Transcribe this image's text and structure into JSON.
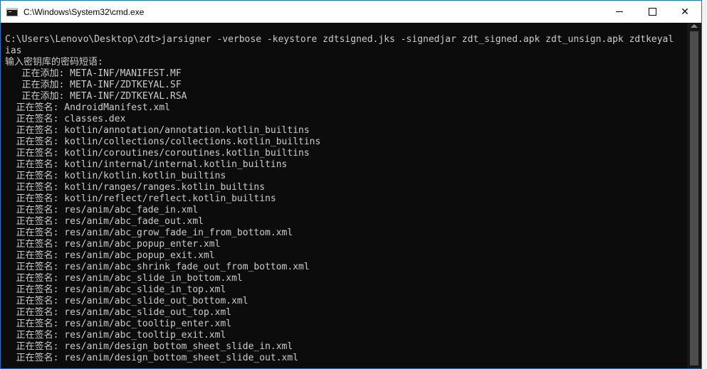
{
  "window": {
    "title": "C:\\Windows\\System32\\cmd.exe",
    "controls": {
      "minimize": "minimize",
      "maximize": "maximize",
      "close": "✕"
    }
  },
  "console": {
    "lines": [
      "C:\\Users\\Lenovo\\Desktop\\zdt>jarsigner -verbose -keystore zdtsigned.jks -signedjar zdt_signed.apk zdt_unsign.apk zdtkeyal",
      "ias",
      "输入密钥库的密码短语:",
      "   正在添加: META-INF/MANIFEST.MF",
      "   正在添加: META-INF/ZDTKEYAL.SF",
      "   正在添加: META-INF/ZDTKEYAL.RSA",
      "  正在签名: AndroidManifest.xml",
      "  正在签名: classes.dex",
      "  正在签名: kotlin/annotation/annotation.kotlin_builtins",
      "  正在签名: kotlin/collections/collections.kotlin_builtins",
      "  正在签名: kotlin/coroutines/coroutines.kotlin_builtins",
      "  正在签名: kotlin/internal/internal.kotlin_builtins",
      "  正在签名: kotlin/kotlin.kotlin_builtins",
      "  正在签名: kotlin/ranges/ranges.kotlin_builtins",
      "  正在签名: kotlin/reflect/reflect.kotlin_builtins",
      "  正在签名: res/anim/abc_fade_in.xml",
      "  正在签名: res/anim/abc_fade_out.xml",
      "  正在签名: res/anim/abc_grow_fade_in_from_bottom.xml",
      "  正在签名: res/anim/abc_popup_enter.xml",
      "  正在签名: res/anim/abc_popup_exit.xml",
      "  正在签名: res/anim/abc_shrink_fade_out_from_bottom.xml",
      "  正在签名: res/anim/abc_slide_in_bottom.xml",
      "  正在签名: res/anim/abc_slide_in_top.xml",
      "  正在签名: res/anim/abc_slide_out_bottom.xml",
      "  正在签名: res/anim/abc_slide_out_top.xml",
      "  正在签名: res/anim/abc_tooltip_enter.xml",
      "  正在签名: res/anim/abc_tooltip_exit.xml",
      "  正在签名: res/anim/design_bottom_sheet_slide_in.xml",
      "  正在签名: res/anim/design_bottom_sheet_slide_out.xml"
    ]
  },
  "colors": {
    "console_bg": "#0c0c0c",
    "console_text": "#cccccc",
    "titlebar_bg": "#ffffff",
    "window_border": "#1d70c6"
  }
}
